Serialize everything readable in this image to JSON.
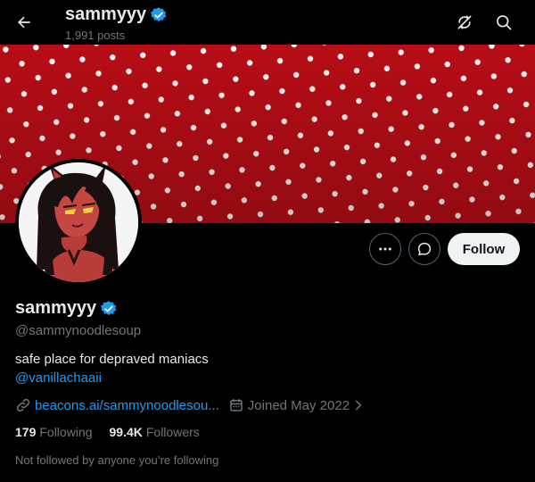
{
  "header": {
    "title": "sammyyy",
    "post_count": "1,991 posts"
  },
  "profile": {
    "display_name": "sammyyy",
    "handle": "@sammynoodlesoup",
    "bio": "safe place for depraved maniacs",
    "bio_mention": "@vanillachaaii",
    "website": "beacons.ai/sammynoodlesou...",
    "joined": "Joined May 2022",
    "following_count": "179",
    "following_label": "Following",
    "followers_count": "99.4K",
    "followers_label": "Followers",
    "followed_by_note": "Not followed by anyone you’re following"
  },
  "actions": {
    "follow_label": "Follow"
  },
  "colors": {
    "accent_blue": "#1d9bf0",
    "banner_red": "#b70d16",
    "muted_text": "#71767b",
    "background": "#000000"
  },
  "icons": {
    "back": "arrow-left-icon",
    "header_1": "refresh-slash-icon",
    "header_2": "search-icon",
    "more": "more-dots-icon",
    "message": "message-bubble-icon",
    "link": "link-icon",
    "calendar": "calendar-icon",
    "verified": "verified-badge-icon"
  }
}
